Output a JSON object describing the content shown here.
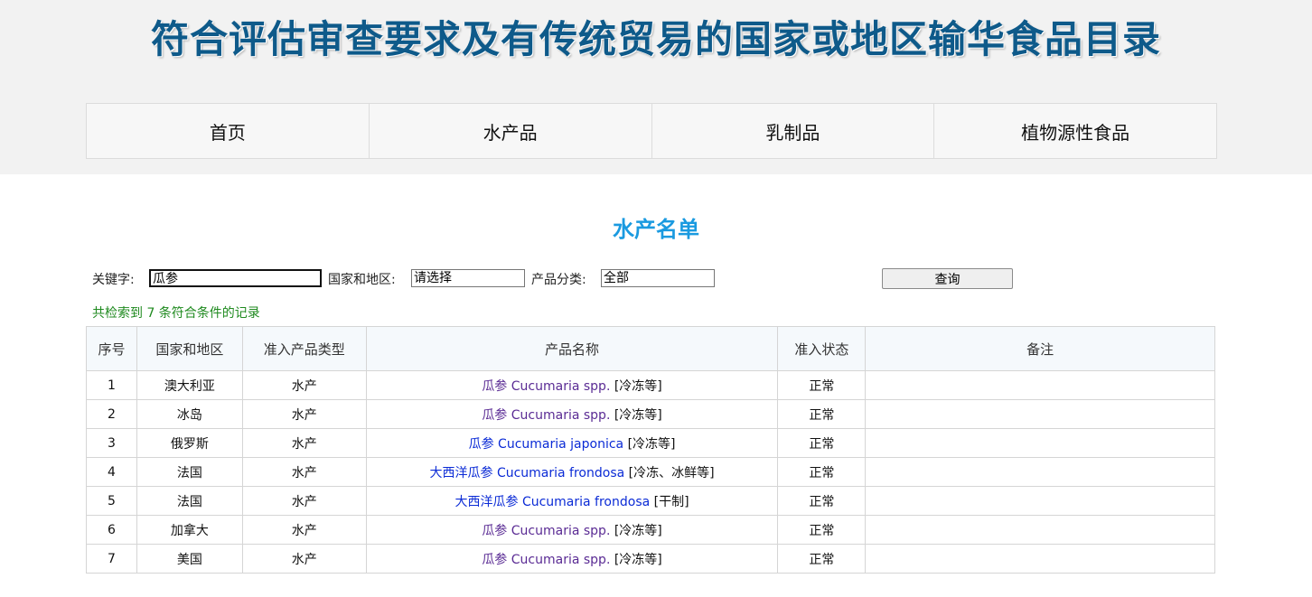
{
  "header": {
    "banner_title": "符合评估审查要求及有传统贸易的国家或地区输华食品目录"
  },
  "nav": {
    "items": [
      {
        "label": "首页"
      },
      {
        "label": "水产品"
      },
      {
        "label": "乳制品"
      },
      {
        "label": "植物源性食品"
      }
    ]
  },
  "main": {
    "title": "水产名单",
    "search": {
      "keyword_label": "关键字:",
      "keyword_value": "瓜参",
      "region_label": "国家和地区:",
      "region_value": "请选择",
      "category_label": "产品分类:",
      "category_value": "全部",
      "query_button": "查询"
    },
    "result_count": "共检索到 7 条符合条件的记录",
    "table": {
      "columns": [
        "序号",
        "国家和地区",
        "准入产品类型",
        "产品名称",
        "准入状态",
        "备注"
      ],
      "rows": [
        {
          "no": "1",
          "region": "澳大利亚",
          "type": "水产",
          "product": "瓜参 Cucumaria spp.",
          "extra": "[冷冻等]",
          "status": "正常",
          "note": "",
          "link_color": "#5a2b94"
        },
        {
          "no": "2",
          "region": "冰岛",
          "type": "水产",
          "product": "瓜参 Cucumaria spp.",
          "extra": "[冷冻等]",
          "status": "正常",
          "note": "",
          "link_color": "#5a2b94"
        },
        {
          "no": "3",
          "region": "俄罗斯",
          "type": "水产",
          "product": "瓜参 Cucumaria japonica",
          "extra": "[冷冻等]",
          "status": "正常",
          "note": "",
          "link_color": "#0b2bd6"
        },
        {
          "no": "4",
          "region": "法国",
          "type": "水产",
          "product": "大西洋瓜参 Cucumaria frondosa",
          "extra": "[冷冻、冰鲜等]",
          "status": "正常",
          "note": "",
          "link_color": "#0b2bd6"
        },
        {
          "no": "5",
          "region": "法国",
          "type": "水产",
          "product": "大西洋瓜参 Cucumaria frondosa",
          "extra": "[干制]",
          "status": "正常",
          "note": "",
          "link_color": "#0b2bd6"
        },
        {
          "no": "6",
          "region": "加拿大",
          "type": "水产",
          "product": "瓜参 Cucumaria spp.",
          "extra": "[冷冻等]",
          "status": "正常",
          "note": "",
          "link_color": "#5a2b94"
        },
        {
          "no": "7",
          "region": "美国",
          "type": "水产",
          "product": "瓜参 Cucumaria spp.",
          "extra": "[冷冻等]",
          "status": "正常",
          "note": "",
          "link_color": "#5a2b94"
        }
      ]
    }
  }
}
